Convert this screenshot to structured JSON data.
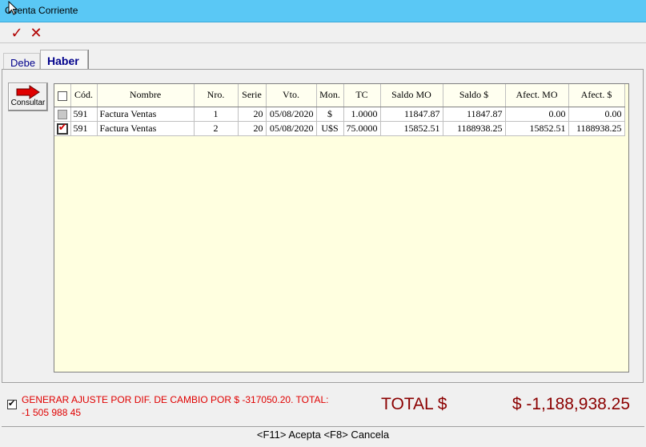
{
  "window": {
    "title": "Cuenta Corriente"
  },
  "toolbar": {
    "accept_symbol": "✓",
    "cancel_symbol": "✕"
  },
  "tabs": [
    {
      "label": "Debe",
      "active": false
    },
    {
      "label": "Haber",
      "active": true
    }
  ],
  "consultar": {
    "label": "Consultar",
    "icon": "red-arrow-icon"
  },
  "grid": {
    "headers": [
      "Cód.",
      "Nombre",
      "Nro.",
      "Serie",
      "Vto.",
      "Mon.",
      "TC",
      "Saldo MO",
      "Saldo $",
      "Afect. MO",
      "Afect. $"
    ],
    "rows": [
      {
        "selected": false,
        "cod": "591",
        "nombre": "Factura Ventas",
        "nro": "1",
        "serie": "20",
        "vto": "05/08/2020",
        "mon": "$",
        "tc": "1.0000",
        "saldo_mo": "11847.87",
        "saldo_pesos": "11847.87",
        "afect_mo": "0.00",
        "afect_pesos": "0.00"
      },
      {
        "selected": true,
        "cod": "591",
        "nombre": "Factura Ventas",
        "nro": "2",
        "serie": "20",
        "vto": "05/08/2020",
        "mon": "U$S",
        "tc": "75.0000",
        "saldo_mo": "15852.51",
        "saldo_pesos": "1188938.25",
        "afect_mo": "15852.51",
        "afect_pesos": "1188938.25"
      }
    ]
  },
  "ajuste": {
    "checked": true,
    "text": "GENERAR AJUSTE POR DIF. DE CAMBIO POR  $ -317050.20.  TOTAL: -1 505 988 45"
  },
  "total": {
    "label": "TOTAL $",
    "value": "$ -1,188,938.25"
  },
  "status": {
    "text": "<F11> Acepta <F8> Cancela"
  },
  "colors": {
    "titlebar": "#5ac8f5",
    "grid_bg": "#ffffe0",
    "total_text": "#8b0000",
    "warning_text": "#e00000"
  }
}
